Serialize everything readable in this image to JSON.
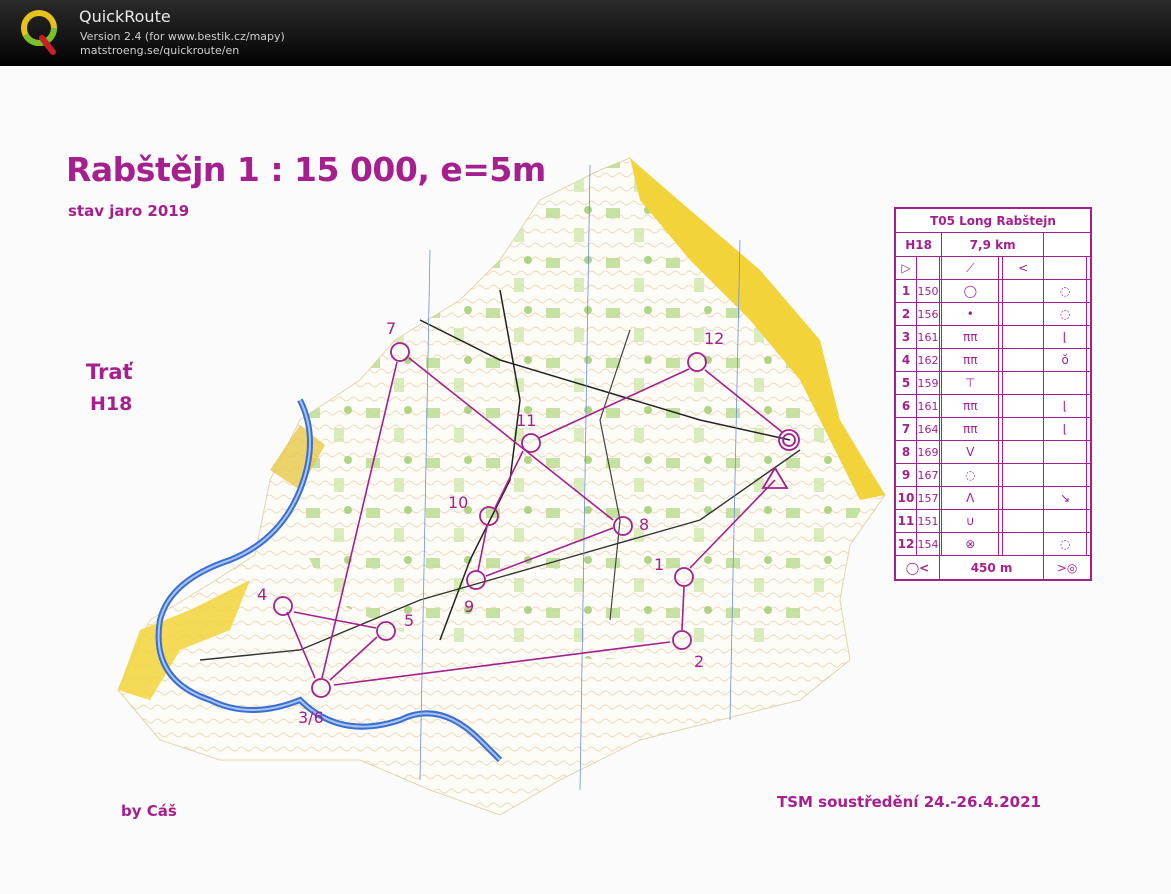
{
  "app": {
    "name": "QuickRoute",
    "version": "Version 2.4  (for www.bestik.cz/mapy)",
    "url": "matstroeng.se/quickroute/en"
  },
  "map": {
    "title": "Rabštějn 1 : 15 000, e=5m",
    "subtitle": "stav jaro 2019",
    "course_label": "Trať",
    "category": "H18",
    "author": "by Cáš",
    "event": "TSM soustředění 24.-26.4.2021",
    "colors": {
      "course": "#a51f8e",
      "water": "#3a6fd1",
      "open_land": "#f2d33a",
      "vegetation": "#9ccb6b"
    }
  },
  "controls": [
    {
      "label": "1"
    },
    {
      "label": "2"
    },
    {
      "label": "3/6"
    },
    {
      "label": "4"
    },
    {
      "label": "5"
    },
    {
      "label": "7"
    },
    {
      "label": "8"
    },
    {
      "label": "9"
    },
    {
      "label": "10"
    },
    {
      "label": "11"
    },
    {
      "label": "12"
    }
  ],
  "descriptions": {
    "title": "T05 Long Rabštejn",
    "category": "H18",
    "length": "7,9 km",
    "finish_distance": "450 m",
    "rows": [
      {
        "num": "1",
        "code": "150",
        "symbol": "◯",
        "where": "◌"
      },
      {
        "num": "2",
        "code": "156",
        "symbol": "•",
        "where": "◌"
      },
      {
        "num": "3",
        "code": "161",
        "symbol": "ππ",
        "where": "⌊"
      },
      {
        "num": "4",
        "code": "162",
        "symbol": "ππ",
        "where": "ŏ"
      },
      {
        "num": "5",
        "code": "159",
        "symbol": "⊤",
        "where": ""
      },
      {
        "num": "6",
        "code": "161",
        "symbol": "ππ",
        "where": "⌊"
      },
      {
        "num": "7",
        "code": "164",
        "symbol": "ππ",
        "where": "⌊"
      },
      {
        "num": "8",
        "code": "169",
        "symbol": "V",
        "where": ""
      },
      {
        "num": "9",
        "code": "167",
        "symbol": "◌",
        "where": ""
      },
      {
        "num": "10",
        "code": "157",
        "symbol": "Λ",
        "where": "↘"
      },
      {
        "num": "11",
        "code": "151",
        "symbol": "∪",
        "where": ""
      },
      {
        "num": "12",
        "code": "154",
        "symbol": "⊗",
        "where": "◌"
      }
    ]
  }
}
